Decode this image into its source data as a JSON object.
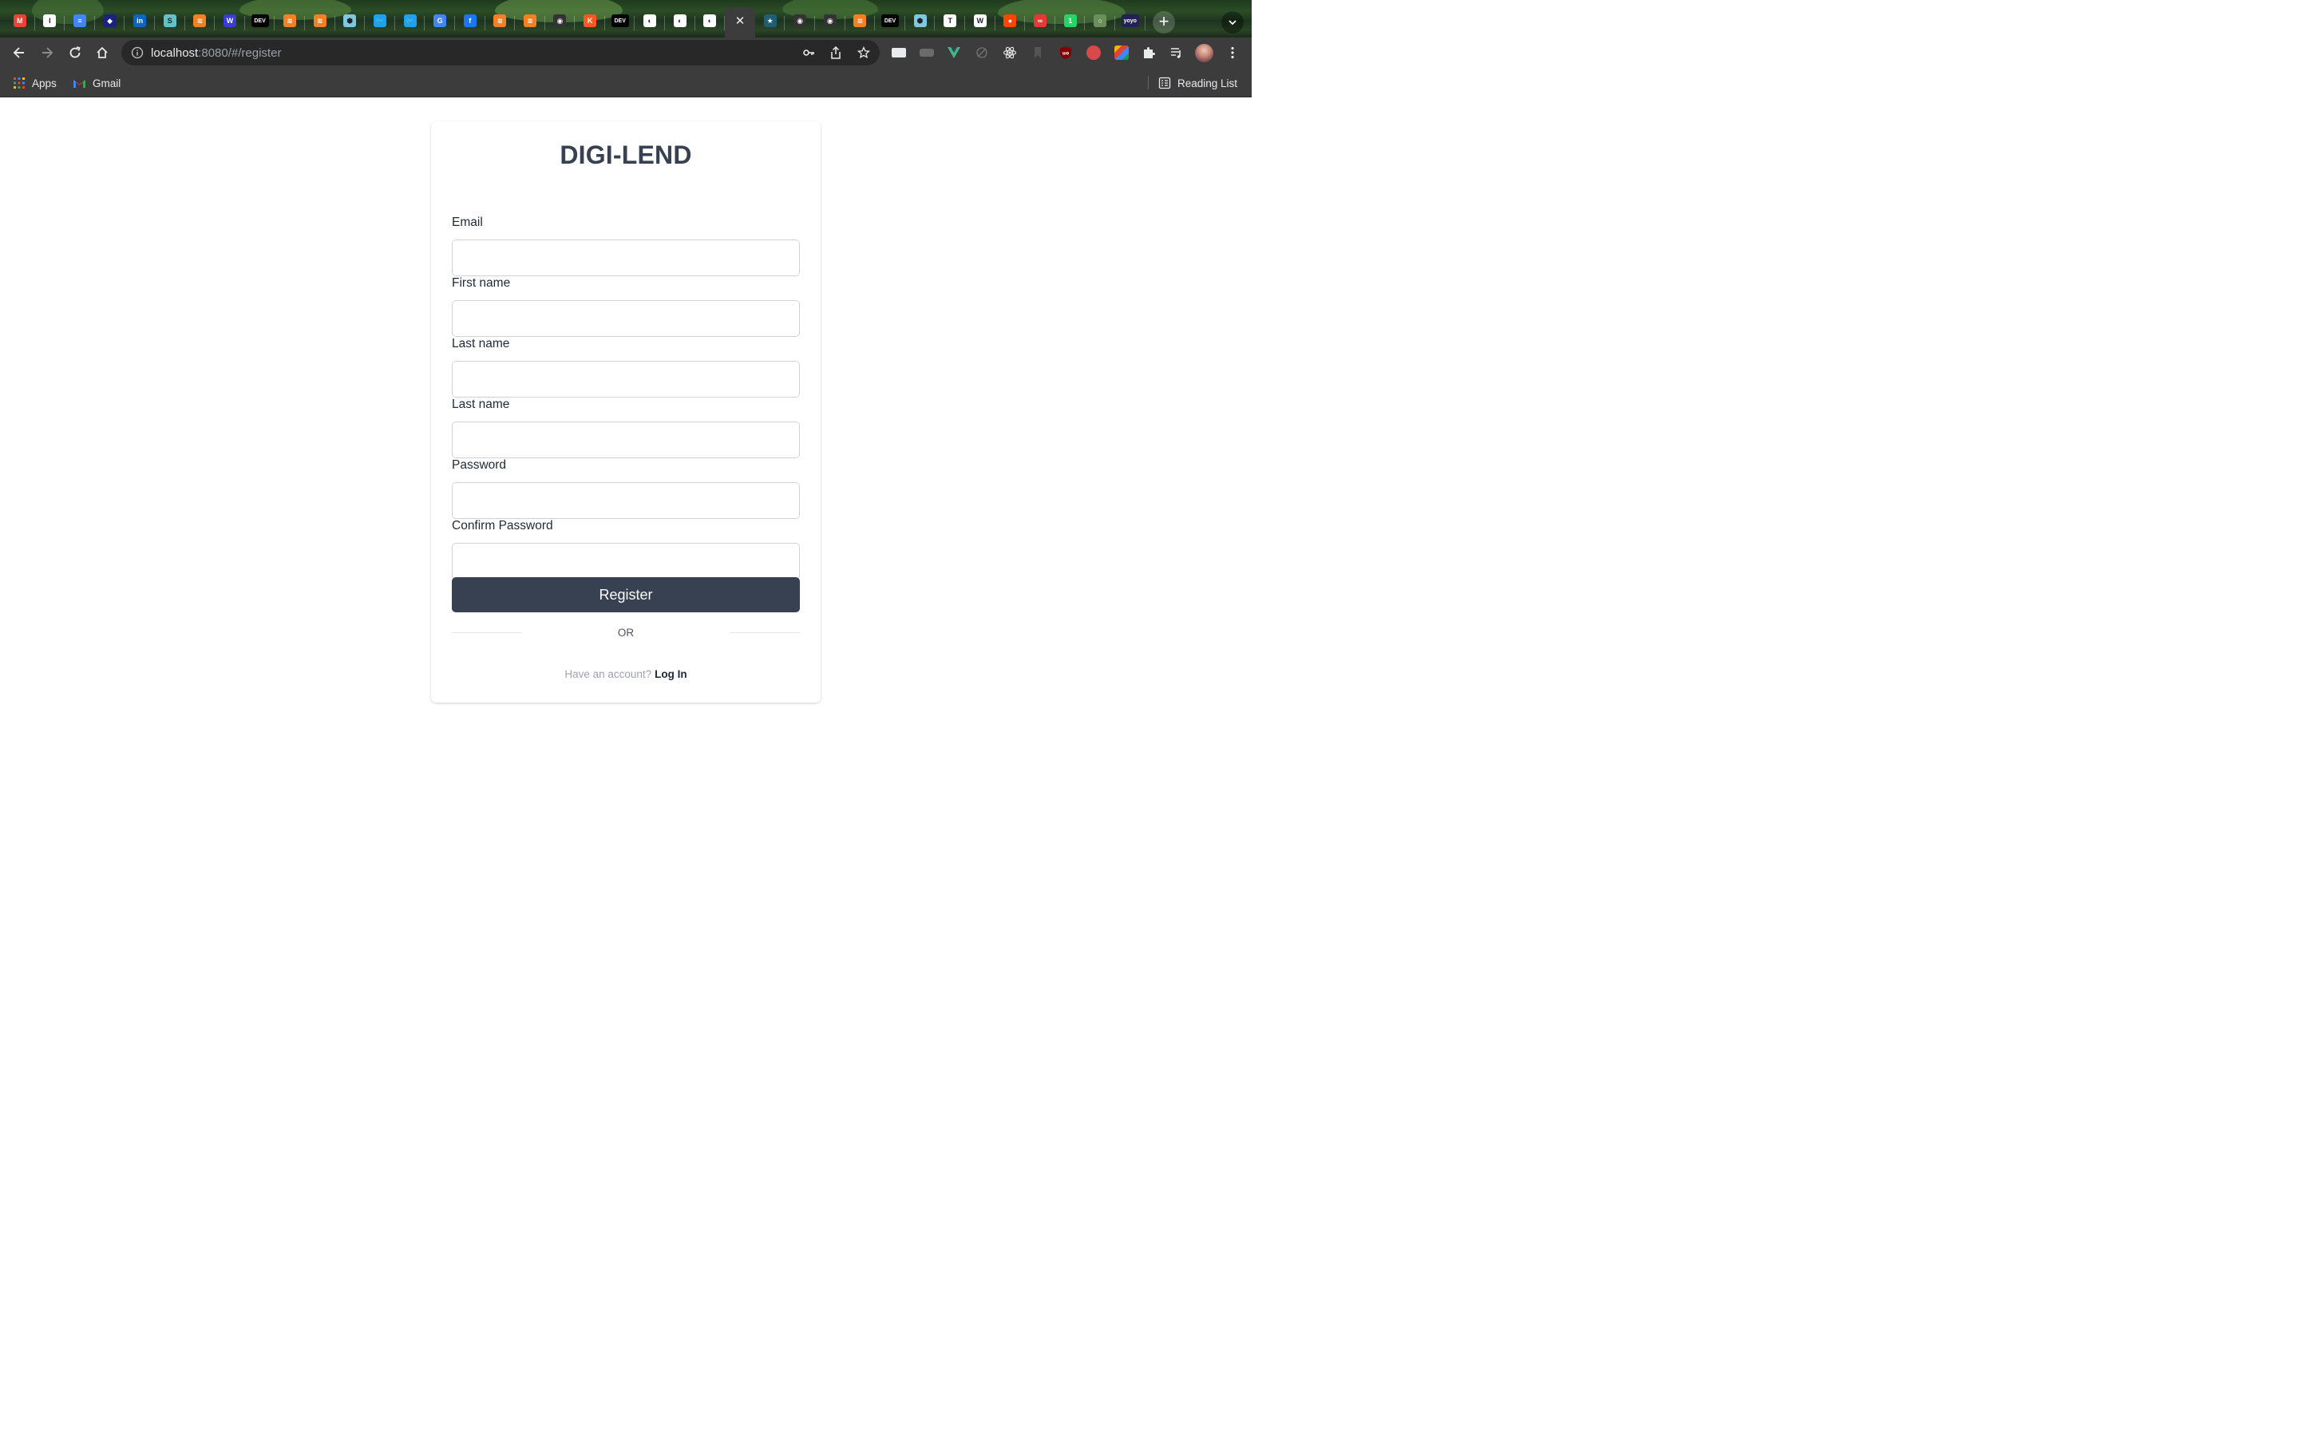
{
  "browser": {
    "tabs": [
      {
        "icon": "gmail-icon",
        "color": "#ea4335",
        "glyph": "M"
      },
      {
        "icon": "instapaper-icon",
        "color": "#ffffff",
        "glyph": "I"
      },
      {
        "icon": "google-docs-icon",
        "color": "#4285f4",
        "glyph": "≡"
      },
      {
        "icon": "bookmark-app-icon",
        "color": "#1a237e",
        "glyph": "◆"
      },
      {
        "icon": "linkedin-icon",
        "color": "#0a66c2",
        "glyph": "in"
      },
      {
        "icon": "s-app-icon",
        "color": "#5fc4c9",
        "glyph": "S"
      },
      {
        "icon": "stackoverflow-icon",
        "color": "#f48024",
        "glyph": "≋"
      },
      {
        "icon": "w-app-icon",
        "color": "#3b3bd6",
        "glyph": "W"
      },
      {
        "icon": "dev-icon",
        "color": "#000000",
        "glyph": "DEV"
      },
      {
        "icon": "stackoverflow-icon",
        "color": "#f48024",
        "glyph": "≋"
      },
      {
        "icon": "stackoverflow-icon",
        "color": "#f48024",
        "glyph": "≋"
      },
      {
        "icon": "cube-icon",
        "color": "#7ec8e3",
        "glyph": "⬢"
      },
      {
        "icon": "twitter-icon",
        "color": "#1da1f2",
        "glyph": "🐦"
      },
      {
        "icon": "twitter-icon",
        "color": "#1da1f2",
        "glyph": "🐦"
      },
      {
        "icon": "google-icon",
        "color": "#4285f4",
        "glyph": "G"
      },
      {
        "icon": "facebook-icon",
        "color": "#1877f2",
        "glyph": "f"
      },
      {
        "icon": "stackoverflow-icon",
        "color": "#f48024",
        "glyph": "≋"
      },
      {
        "icon": "stackoverflow-icon",
        "color": "#f48024",
        "glyph": "≋"
      },
      {
        "icon": "github-icon",
        "color": "#333333",
        "glyph": "◉"
      },
      {
        "icon": "k-app-icon",
        "color": "#ff5722",
        "glyph": "K"
      },
      {
        "icon": "dev-icon",
        "color": "#000000",
        "glyph": "DEV"
      },
      {
        "icon": "globe-icon",
        "color": "#ffffff",
        "glyph": "◐"
      },
      {
        "icon": "globe-icon",
        "color": "#ffffff",
        "glyph": "◐"
      },
      {
        "icon": "globe-icon",
        "color": "#ffffff",
        "glyph": "◐"
      },
      {
        "icon": "close-icon",
        "color": "#e8eaed",
        "glyph": "✕",
        "active": true
      },
      {
        "icon": "star-app-icon",
        "color": "#1e5f74",
        "glyph": "★"
      },
      {
        "icon": "github-icon",
        "color": "#333333",
        "glyph": "◉"
      },
      {
        "icon": "github-icon",
        "color": "#333333",
        "glyph": "◉"
      },
      {
        "icon": "stackoverflow-icon",
        "color": "#f48024",
        "glyph": "≋"
      },
      {
        "icon": "dev-icon",
        "color": "#000000",
        "glyph": "DEV"
      },
      {
        "icon": "cube-icon",
        "color": "#7ec8e3",
        "glyph": "⬢"
      },
      {
        "icon": "instapaper-icon",
        "color": "#ffffff",
        "glyph": "T"
      },
      {
        "icon": "chart-app-icon",
        "color": "#ffffff",
        "glyph": "W"
      },
      {
        "icon": "reddit-icon",
        "color": "#ff4500",
        "glyph": "●"
      },
      {
        "icon": "link-app-icon",
        "color": "#e53935",
        "glyph": "∞"
      },
      {
        "icon": "whatsapp-icon",
        "color": "#25d366",
        "glyph": "1"
      },
      {
        "icon": "circle-app-icon",
        "color": "#6b8e5a",
        "glyph": "○"
      },
      {
        "icon": "yoyo-icon",
        "color": "#222255",
        "glyph": "yoyo"
      }
    ],
    "new_tab_label": "+",
    "url_host": "localhost",
    "url_rest": ":8080/#/register",
    "bookmarks": {
      "apps_label": "Apps",
      "gmail_label": "Gmail",
      "reading_list_label": "Reading List"
    }
  },
  "form": {
    "brand": "DIGI-LEND",
    "fields": [
      {
        "label": "Email",
        "value": ""
      },
      {
        "label": "First name",
        "value": ""
      },
      {
        "label": "Last name",
        "value": ""
      },
      {
        "label": "Last name",
        "value": ""
      },
      {
        "label": "Password",
        "value": ""
      },
      {
        "label": "Confirm Password",
        "value": ""
      }
    ],
    "register_label": "Register",
    "or_label": "OR",
    "have_account_text": "Have an account?",
    "login_label": "Log In"
  },
  "colors": {
    "primary_button": "#374151",
    "brand_text": "#374151",
    "browser_chrome": "#3c3c3c"
  }
}
